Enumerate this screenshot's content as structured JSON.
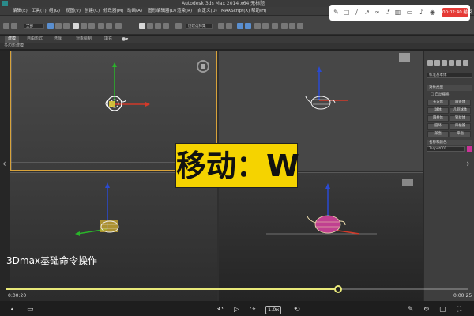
{
  "window": {
    "title": "Autodesk 3ds Max  2014 x64      无标题"
  },
  "menu": {
    "items": [
      "编辑(E)",
      "工具(T)",
      "组(G)",
      "视图(V)",
      "创建(C)",
      "修改器(M)",
      "动画(A)",
      "图形编辑器(D)",
      "渲染(R)",
      "自定义(U)",
      "MAXScript(X)",
      "帮助(H)"
    ]
  },
  "toolbar": {
    "selection_filter": "全部",
    "named_selection": "创建选择集"
  },
  "ribbon": {
    "tabs": [
      "建模",
      "自由形式",
      "选择",
      "对象绘制",
      "填充"
    ],
    "sub_label": "多边形建模"
  },
  "viewports": {
    "topleft_label": "",
    "object_colors": {
      "teapot_selected": "#ffffff",
      "teapot_normal": "#e8e8b0",
      "teapot_shaded": "#c04090"
    }
  },
  "command_panel": {
    "dropdown": "标准基本体",
    "section_object_type": "对象类型",
    "autogrid": "自动栅格",
    "buttons": [
      "长方体",
      "圆锥体",
      "球体",
      "几何球体",
      "圆柱体",
      "管状体",
      "圆环",
      "四棱锥",
      "茶壶",
      "平面"
    ],
    "section_name_color": "名称和颜色",
    "object_name": "Teapot001",
    "object_color": "#cc3399"
  },
  "overlay": {
    "caption": "移动：W",
    "subtitle": "3Dmax基础命令操作"
  },
  "player": {
    "record_label": "00:02:40 结束",
    "current_time": "0:00:20",
    "total_time": "0:00:25",
    "progress": 0.72,
    "speed": "1.0x",
    "top_icons": [
      "pen-icon",
      "square-icon",
      "pencil-icon",
      "arrow-icon",
      "link-icon",
      "undo-icon",
      "trash-icon",
      "video-icon",
      "mic-icon",
      "camera-icon"
    ]
  }
}
